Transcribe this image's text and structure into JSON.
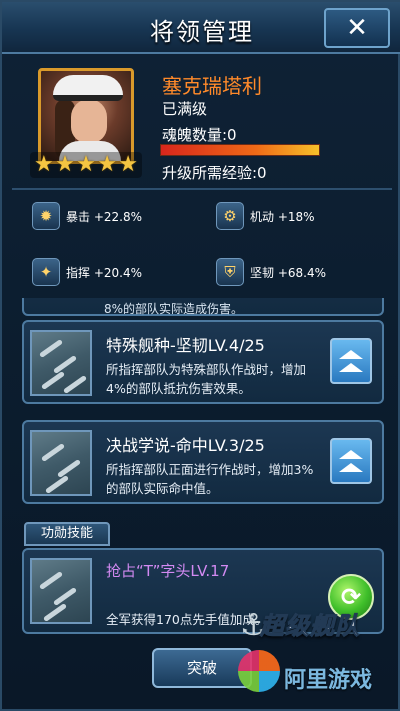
{
  "header": {
    "title": "将领管理",
    "close_label": "✕"
  },
  "hero": {
    "name": "塞克瑞塔利",
    "level_status": "已满级",
    "soul_label": "魂魄数量:0",
    "xp_label": "升级所需经验:0",
    "xp_progress": 1.0,
    "stars": [
      "★",
      "★",
      "★",
      "★",
      "★"
    ],
    "star_count": 5
  },
  "stats": [
    {
      "icon": "critical-icon",
      "label": "暴击 +22.8%"
    },
    {
      "icon": "mobility-icon",
      "label": "机动 +18%"
    },
    {
      "icon": "command-icon",
      "label": "指挥 +20.4%"
    },
    {
      "icon": "toughness-icon",
      "label": "坚韧 +68.4%"
    }
  ],
  "skills": {
    "partial_text": "8%的部队实际造成伤害。",
    "items": [
      {
        "name": "特殊舰种-坚韧LV.4/25",
        "desc": "所指挥部队为特殊部队作战时，增加4%的部队抵抗伤害效果。"
      },
      {
        "name": "决战学说-命中LV.3/25",
        "desc": "所指挥部队正面进行作战时，增加3%的部队实际命中值。"
      }
    ]
  },
  "merit": {
    "tab_label": "功勋技能",
    "name": "抢占“T”字头LV.17",
    "desc": "全军获得170点先手值加成。",
    "refresh_label": "⟳"
  },
  "footer": {
    "breakthrough_label": "突破"
  },
  "watermark": {
    "brand": "超级舰队",
    "site": "阿里游戏"
  },
  "colors": {
    "hero_name": "#ff8a2a",
    "merit_name": "#d28af2",
    "portrait_border": "#d99a2b",
    "upgrade_button": "#2a79c0"
  }
}
